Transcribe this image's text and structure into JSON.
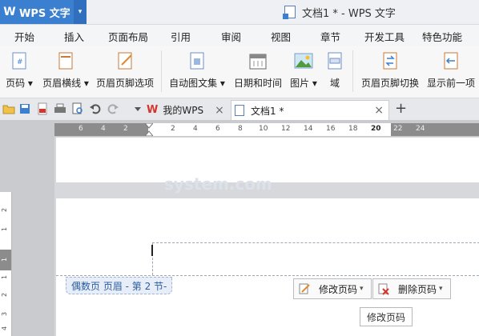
{
  "app": {
    "logo_letter": "W",
    "name": "WPS 文字",
    "dropdown_arrow": "▾"
  },
  "window": {
    "title": "文档1 * - WPS 文字"
  },
  "menu_tabs": [
    "开始",
    "插入",
    "页面布局",
    "引用",
    "审阅",
    "视图",
    "章节",
    "开发工具",
    "特色功能"
  ],
  "ribbon": {
    "buttons": [
      {
        "label": "页码",
        "icon": "page-number-icon",
        "dropdown": true
      },
      {
        "label": "页眉横线",
        "icon": "header-line-icon",
        "dropdown": true
      },
      {
        "label": "页眉页脚选项",
        "icon": "header-footer-options-icon",
        "dropdown": false
      },
      {
        "label": "自动图文集",
        "icon": "autotext-icon",
        "dropdown": true
      },
      {
        "label": "日期和时间",
        "icon": "calendar-icon",
        "dropdown": false
      },
      {
        "label": "图片",
        "icon": "picture-icon",
        "dropdown": true
      },
      {
        "label": "域",
        "icon": "field-icon",
        "dropdown": false
      },
      {
        "label": "页眉页脚切换",
        "icon": "header-footer-switch-icon",
        "dropdown": false
      },
      {
        "label": "显示前一项",
        "icon": "show-previous-icon",
        "dropdown": false
      }
    ],
    "dropdown_arrow": "▾"
  },
  "doc_tabs": [
    {
      "label": "我的WPS",
      "icon": "wps-logo-icon",
      "active": false
    },
    {
      "label": "文档1 *",
      "icon": "document-icon",
      "active": true
    }
  ],
  "tab_close": "×",
  "new_tab": "+",
  "ruler": {
    "ticks": [
      "6",
      "4",
      "2",
      "2",
      "4",
      "6",
      "8",
      "10",
      "12",
      "14",
      "16",
      "18",
      "20",
      "22",
      "24"
    ]
  },
  "vruler": {
    "ticks": [
      "2",
      "1",
      "1",
      "1",
      "2",
      "3",
      "4"
    ]
  },
  "header": {
    "label": "偶数页 页眉 - 第 2 节-"
  },
  "float_buttons": {
    "edit_page_number": "修改页码",
    "delete_page_number": "删除页码"
  },
  "tooltip": "修改页码",
  "watermark": "system.com",
  "colors": {
    "accent": "#3b7fd0",
    "header_label": "#2b5da0"
  }
}
